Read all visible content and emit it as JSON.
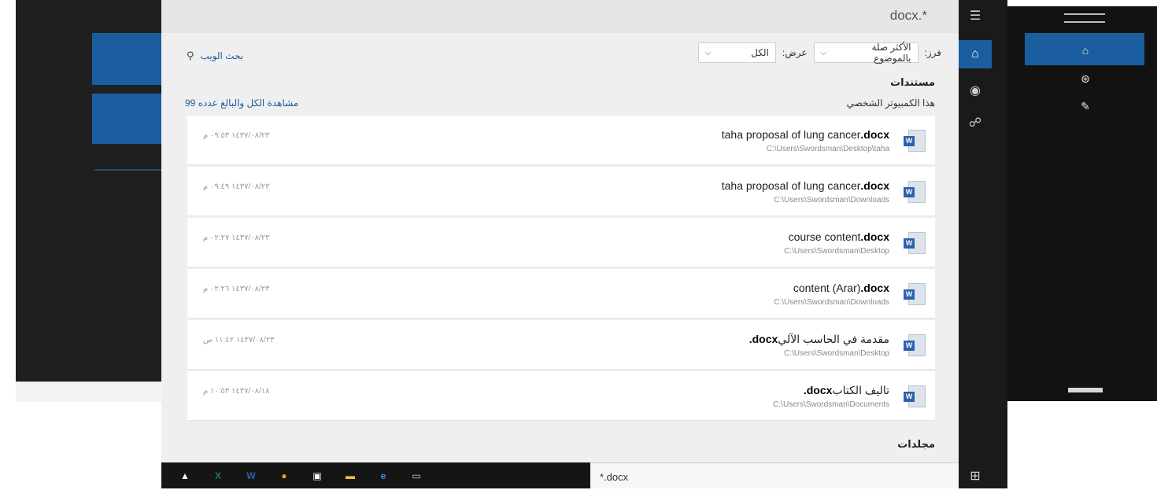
{
  "query_title": "docx.*",
  "header": {
    "web_search_label": "بحث الويب",
    "sort_label": "فرز:",
    "sort_value": "الأكثر صلة بالموضوع",
    "show_label": "عرض:",
    "show_value": "الكل"
  },
  "documents": {
    "title": "مستندات",
    "subtitle": "هذا الكمبيوتر الشخصي",
    "see_all": "مشاهدة الكل والبالغ عدده 99",
    "items": [
      {
        "name": "taha proposal of lung cancer",
        "ext": ".docx",
        "path": "C:\\Users\\Swordsman\\Desktop\\taha",
        "date": "١٤٣٧/٠٨/٢٣ ٠٩:٥٣ م"
      },
      {
        "name": "taha proposal of lung cancer",
        "ext": ".docx",
        "path": "C:\\Users\\Swordsman\\Downloads",
        "date": "١٤٣٧/٠٨/٢٣ ٠٩:٤٩ م"
      },
      {
        "name": "course content",
        "ext": ".docx",
        "path": "C:\\Users\\Swordsman\\Desktop",
        "date": "١٤٣٧/٠٨/٢٣ ٠٢:٢٧ م"
      },
      {
        "name": "content (Arar)",
        "ext": ".docx",
        "path": "C:\\Users\\Swordsman\\Downloads",
        "date": "١٤٣٧/٠٨/٢٣ ٠٢:٢٦ م"
      },
      {
        "name": "مقدمة في الحاسب الآلي",
        "ext": ".docx",
        "path": "C:\\Users\\Swordsman\\Desktop",
        "date": "١٤٣٧/٠٨/٢٣ ١١:٤٢ ص"
      },
      {
        "name": "تاليف الكتاب",
        "ext": ".docx",
        "path": "C:\\Users\\Swordsman\\Documents",
        "date": "١٤٣٧/٠٨/١٨ ١٠:٥٣ م"
      }
    ]
  },
  "folders_title": "مجلدات",
  "search": {
    "value": "*.docx"
  },
  "taskbar": {
    "icons": [
      {
        "name": "photos-icon",
        "glyph": "▲",
        "color": "#ffffff"
      },
      {
        "name": "excel-icon",
        "glyph": "X",
        "color": "#1d7a45"
      },
      {
        "name": "word-icon",
        "glyph": "W",
        "color": "#2b62b0"
      },
      {
        "name": "chrome-icon",
        "glyph": "●",
        "color": "#e0a020"
      },
      {
        "name": "store-icon",
        "glyph": "▣",
        "color": "#ffffff"
      },
      {
        "name": "file-explorer-icon",
        "glyph": "▬",
        "color": "#f0c040"
      },
      {
        "name": "edge-icon",
        "glyph": "e",
        "color": "#3a8ee6"
      },
      {
        "name": "task-view-icon",
        "glyph": "▭",
        "color": "#cfcfcf"
      }
    ]
  },
  "colors": {
    "accent": "#1b5ea0"
  }
}
